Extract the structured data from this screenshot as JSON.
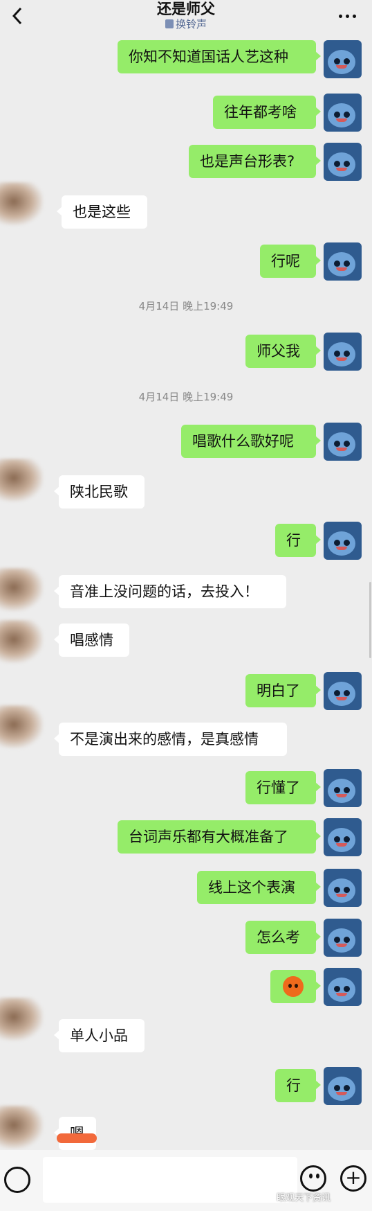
{
  "header": {
    "title": "还是师父",
    "subtitle": "换铃声"
  },
  "messages": [
    {
      "from": "me",
      "text": "你知不知道国话人艺这种"
    },
    {
      "from": "me",
      "text": "往年都考啥"
    },
    {
      "from": "me",
      "text": "也是声台形表?"
    },
    {
      "from": "them",
      "text": "也是这些"
    },
    {
      "from": "me",
      "text": "行呢"
    },
    {
      "from": "time",
      "text": "4月14日 晚上19:49"
    },
    {
      "from": "me",
      "text": "师父我"
    },
    {
      "from": "time",
      "text": "4月14日 晚上19:49"
    },
    {
      "from": "me",
      "text": "唱歌什么歌好呢"
    },
    {
      "from": "them",
      "text": "陕北民歌"
    },
    {
      "from": "me",
      "text": "行"
    },
    {
      "from": "them",
      "text": "音准上没问题的话，去投入！"
    },
    {
      "from": "them",
      "text": "唱感情"
    },
    {
      "from": "me",
      "text": "明白了"
    },
    {
      "from": "them",
      "text": "不是演出来的感情，是真感情"
    },
    {
      "from": "me",
      "text": "行懂了"
    },
    {
      "from": "me",
      "text": "台词声乐都有大概准备了"
    },
    {
      "from": "me",
      "text": "线上这个表演"
    },
    {
      "from": "me",
      "text": "怎么考"
    },
    {
      "from": "me",
      "text": "",
      "icon": "emoji-sticker-icon"
    },
    {
      "from": "them",
      "text": "单人小品"
    },
    {
      "from": "me",
      "text": "行"
    },
    {
      "from": "them",
      "text": "嗯"
    }
  ],
  "watermark": "眼观天下资讯"
}
